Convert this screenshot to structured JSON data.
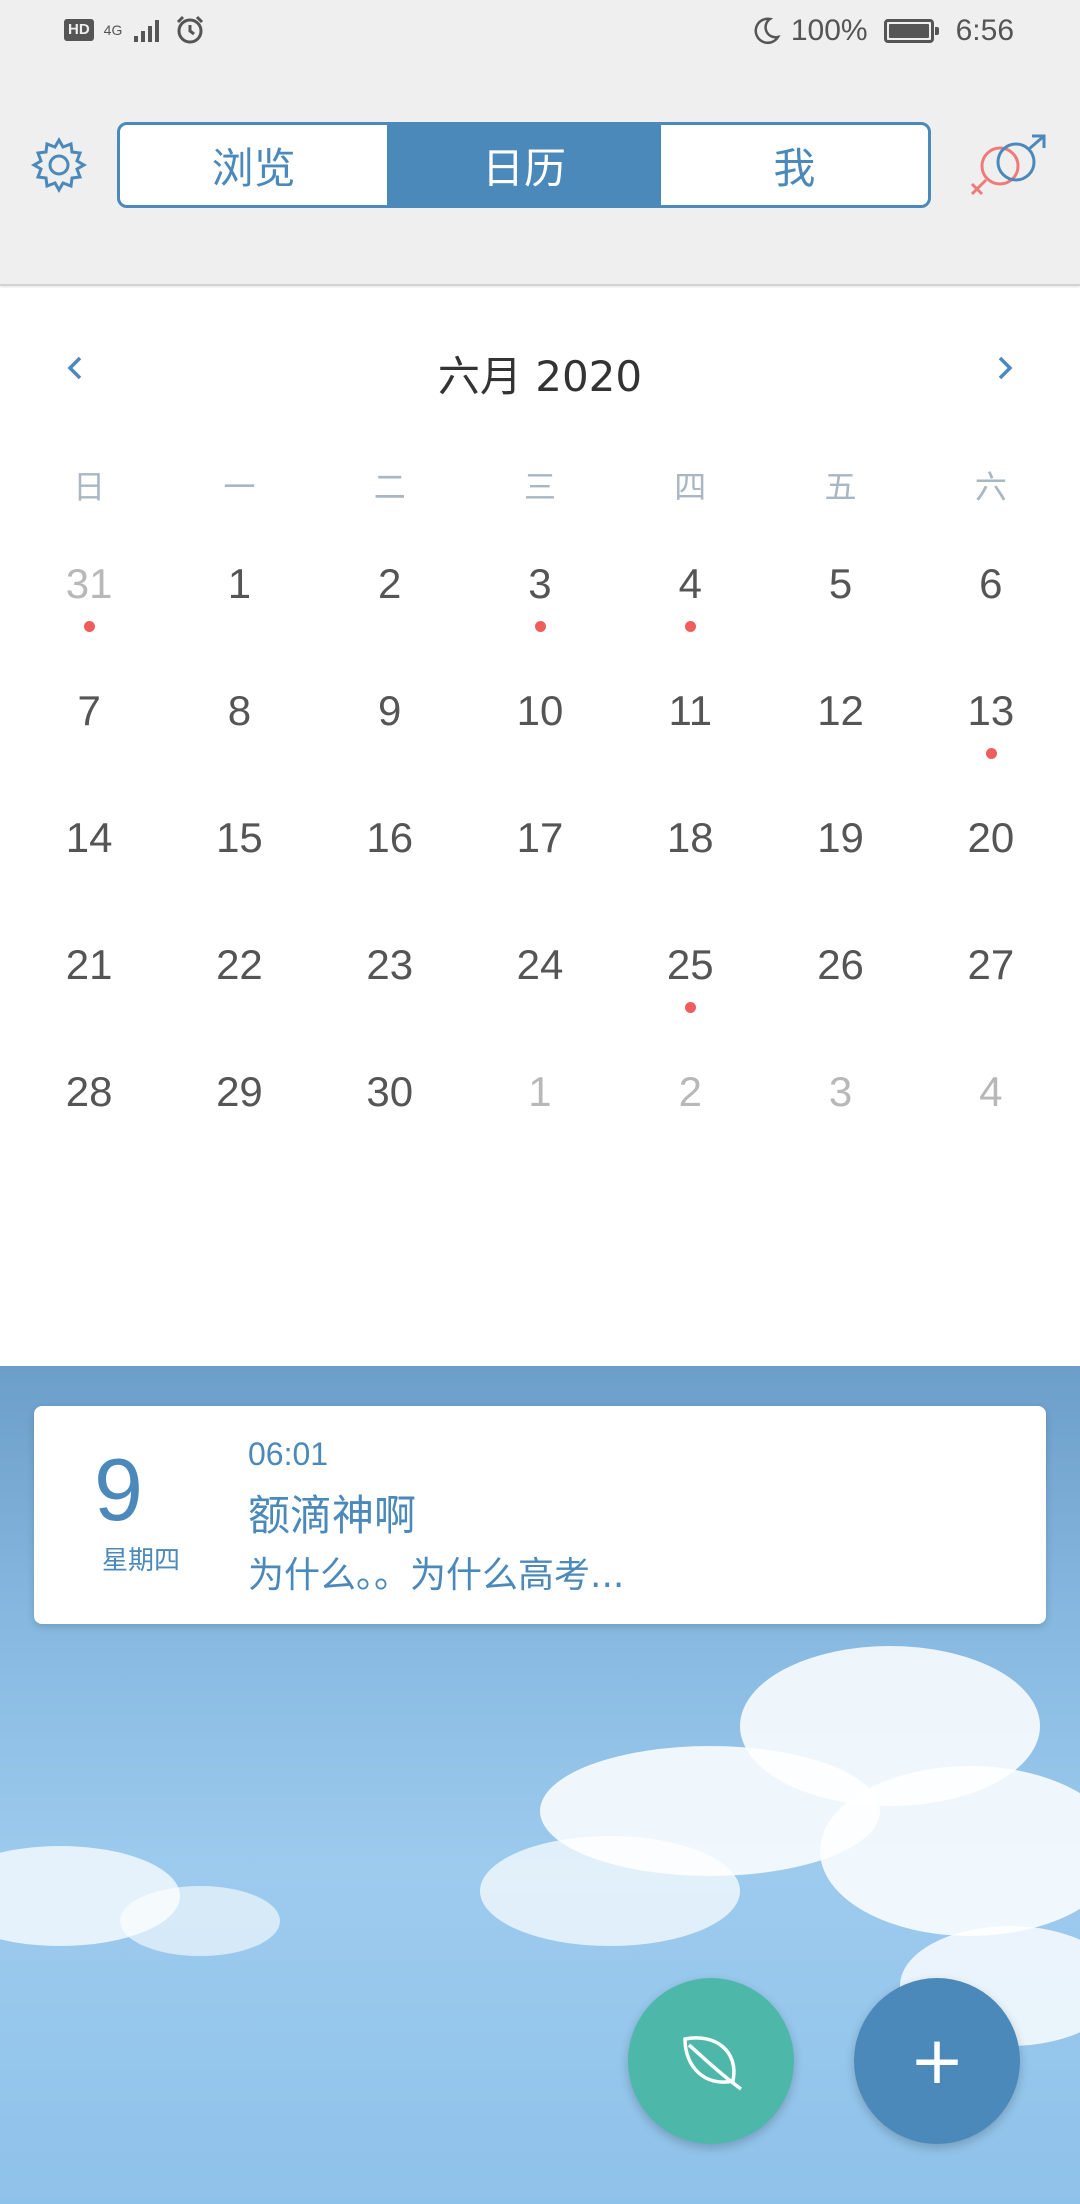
{
  "status_bar": {
    "hd": "HD",
    "network": "4G",
    "battery": "100%",
    "time": "6:56",
    "icons": [
      "alarm-icon",
      "moon-icon",
      "battery-icon",
      "signal-icon"
    ]
  },
  "tabs": [
    {
      "label": "浏览",
      "active": false
    },
    {
      "label": "日历",
      "active": true
    },
    {
      "label": "我",
      "active": false
    }
  ],
  "calendar": {
    "title": "六月 2020",
    "weekdays": [
      "日",
      "一",
      "二",
      "三",
      "四",
      "五",
      "六"
    ],
    "weeks": [
      [
        {
          "d": "31",
          "m": true,
          "dot": true
        },
        {
          "d": "1"
        },
        {
          "d": "2"
        },
        {
          "d": "3",
          "dot": true
        },
        {
          "d": "4",
          "dot": true
        },
        {
          "d": "5"
        },
        {
          "d": "6"
        }
      ],
      [
        {
          "d": "7"
        },
        {
          "d": "8"
        },
        {
          "d": "9"
        },
        {
          "d": "10"
        },
        {
          "d": "11"
        },
        {
          "d": "12"
        },
        {
          "d": "13",
          "dot": true
        }
      ],
      [
        {
          "d": "14"
        },
        {
          "d": "15"
        },
        {
          "d": "16"
        },
        {
          "d": "17"
        },
        {
          "d": "18"
        },
        {
          "d": "19"
        },
        {
          "d": "20"
        }
      ],
      [
        {
          "d": "21"
        },
        {
          "d": "22"
        },
        {
          "d": "23"
        },
        {
          "d": "24"
        },
        {
          "d": "25",
          "dot": true
        },
        {
          "d": "26"
        },
        {
          "d": "27"
        }
      ],
      [
        {
          "d": "28"
        },
        {
          "d": "29"
        },
        {
          "d": "30"
        },
        {
          "d": "1",
          "m": true
        },
        {
          "d": "2",
          "m": true
        },
        {
          "d": "3",
          "m": true
        },
        {
          "d": "4",
          "m": true
        }
      ]
    ]
  },
  "entry": {
    "day": "9",
    "weekday": "星期四",
    "time": "06:01",
    "title": "额滴神啊",
    "preview": "为什么。。为什么高考..."
  },
  "fabs": {
    "add": "+"
  },
  "colors": {
    "accent": "#4b89ba",
    "dot": "#ef5d5d",
    "leaf_fab": "#4db8a9"
  }
}
